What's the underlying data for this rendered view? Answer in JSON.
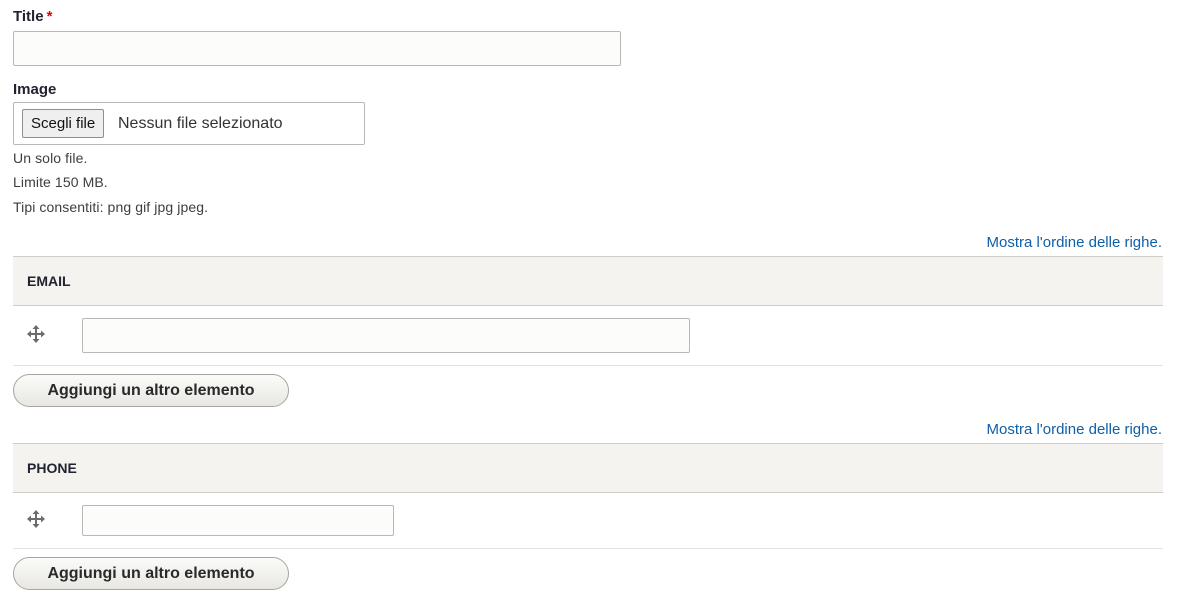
{
  "title_field": {
    "label": "Title",
    "required_mark": "*",
    "value": ""
  },
  "image_field": {
    "label": "Image",
    "choose_button": "Scegli file",
    "no_file_text": "Nessun file selezionato",
    "descriptions": [
      "Un solo file.",
      "Limite 150 MB.",
      "Tipi consentiti: png gif jpg jpeg."
    ]
  },
  "email_table": {
    "row_order_link": "Mostra l'ordine delle righe.",
    "header": "EMAIL",
    "rows": [
      {
        "value": ""
      }
    ],
    "add_button": "Aggiungi un altro elemento"
  },
  "phone_table": {
    "row_order_link": "Mostra l'ordine delle righe.",
    "header": "PHONE",
    "rows": [
      {
        "value": ""
      }
    ],
    "add_button": "Aggiungi un altro elemento"
  },
  "icons": {
    "drag_handle": "move-arrows-icon"
  },
  "colors": {
    "link": "#0f5fa7",
    "required": "#e00000",
    "table_header_bg": "#f4f3ef"
  }
}
